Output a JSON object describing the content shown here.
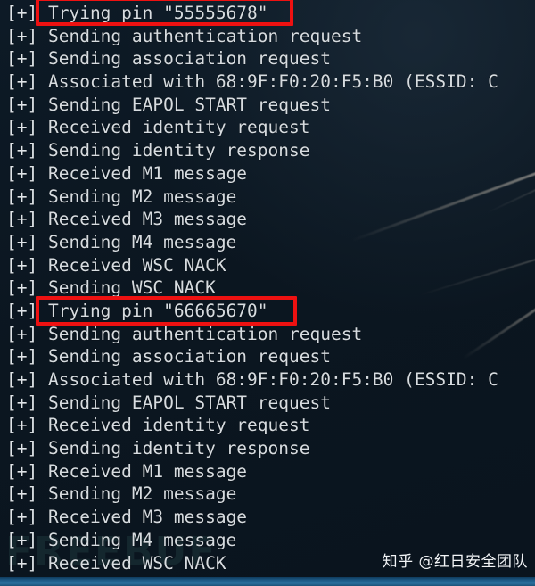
{
  "terminal": {
    "background_color": "#0b1620",
    "text_color": "#d7dce0",
    "prefix": "[+]",
    "lines": [
      {
        "prefix": "[+]",
        "text": "Trying pin \"55555678\"",
        "highlighted": true
      },
      {
        "prefix": "[+]",
        "text": "Sending authentication request",
        "highlighted": false
      },
      {
        "prefix": "[+]",
        "text": "Sending association request",
        "highlighted": false
      },
      {
        "prefix": "[+]",
        "text": "Associated with 68:9F:F0:20:F5:B0 (ESSID: C",
        "highlighted": false
      },
      {
        "prefix": "[+]",
        "text": "Sending EAPOL START request",
        "highlighted": false
      },
      {
        "prefix": "[+]",
        "text": "Received identity request",
        "highlighted": false
      },
      {
        "prefix": "[+]",
        "text": "Sending identity response",
        "highlighted": false
      },
      {
        "prefix": "[+]",
        "text": "Received M1 message",
        "highlighted": false
      },
      {
        "prefix": "[+]",
        "text": "Sending M2 message",
        "highlighted": false
      },
      {
        "prefix": "[+]",
        "text": "Received M3 message",
        "highlighted": false
      },
      {
        "prefix": "[+]",
        "text": "Sending M4 message",
        "highlighted": false
      },
      {
        "prefix": "[+]",
        "text": "Received WSC NACK",
        "highlighted": false
      },
      {
        "prefix": "[+]",
        "text": "Sending WSC NACK",
        "highlighted": false
      },
      {
        "prefix": "[+]",
        "text": "Trying pin \"66665670\"",
        "highlighted": true
      },
      {
        "prefix": "[+]",
        "text": "Sending authentication request",
        "highlighted": false
      },
      {
        "prefix": "[+]",
        "text": "Sending association request",
        "highlighted": false
      },
      {
        "prefix": "[+]",
        "text": "Associated with 68:9F:F0:20:F5:B0 (ESSID: C",
        "highlighted": false
      },
      {
        "prefix": "[+]",
        "text": "Sending EAPOL START request",
        "highlighted": false
      },
      {
        "prefix": "[+]",
        "text": "Received identity request",
        "highlighted": false
      },
      {
        "prefix": "[+]",
        "text": "Sending identity response",
        "highlighted": false
      },
      {
        "prefix": "[+]",
        "text": "Received M1 message",
        "highlighted": false
      },
      {
        "prefix": "[+]",
        "text": "Sending M2 message",
        "highlighted": false
      },
      {
        "prefix": "[+]",
        "text": "Received M3 message",
        "highlighted": false
      },
      {
        "prefix": "[+]",
        "text": "Sending M4 message",
        "highlighted": false
      },
      {
        "prefix": "[+]",
        "text": "Received WSC NACK",
        "highlighted": false
      }
    ]
  },
  "annotations": {
    "highlight_color": "#ee1111",
    "boxes": [
      {
        "label": "Trying pin \"55555678\""
      },
      {
        "label": "Trying pin \"66665670\""
      }
    ]
  },
  "watermarks": {
    "background": "FREEBUF",
    "author": "知乎 @红日安全团队"
  },
  "taskbar": {
    "color": "#1d5c88"
  }
}
